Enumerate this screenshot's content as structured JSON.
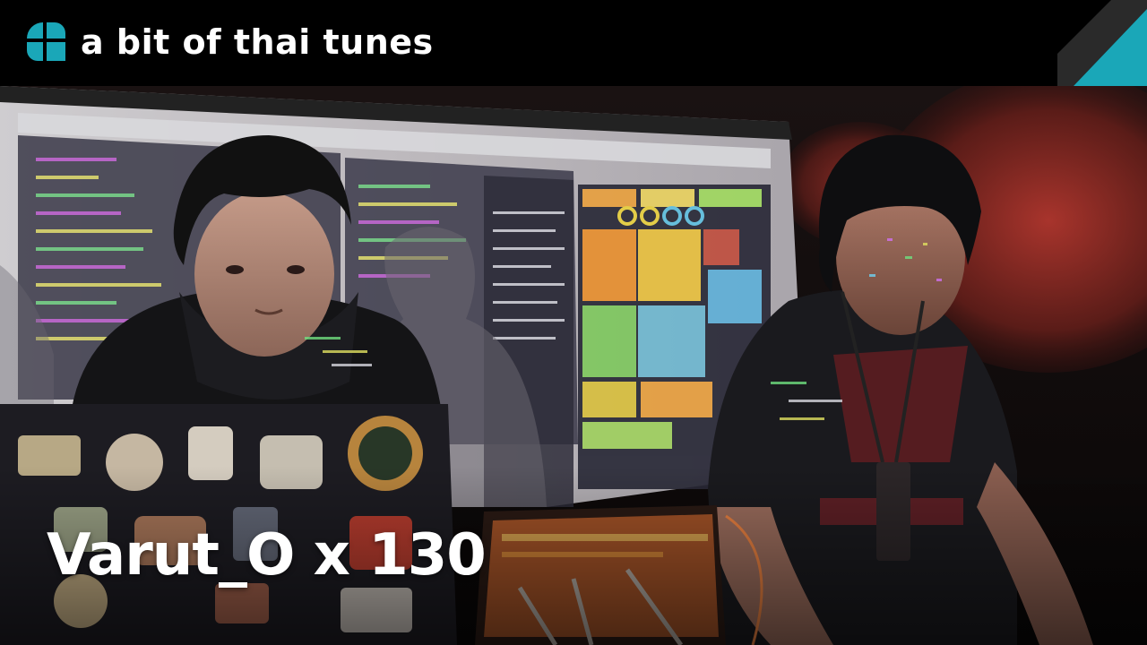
{
  "banner": {
    "title": "a bit of thai tunes",
    "logo_icon": "quadrant-logo-icon",
    "accent_color": "#1aa7b8",
    "background_color": "#000000"
  },
  "caption": {
    "performers": "Varut_O x 130"
  }
}
